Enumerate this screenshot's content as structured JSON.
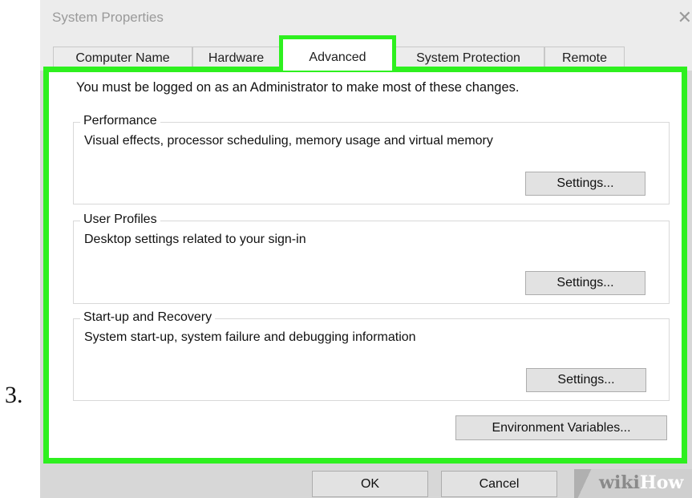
{
  "step_number": "3.",
  "window": {
    "title": "System Properties",
    "close_glyph": "✕"
  },
  "tabs": [
    {
      "label": "Computer Name",
      "active": false
    },
    {
      "label": "Hardware",
      "active": false
    },
    {
      "label": "Advanced",
      "active": true
    },
    {
      "label": "System Protection",
      "active": false
    },
    {
      "label": "Remote",
      "active": false
    }
  ],
  "admin_note": "You must be logged on as an Administrator to make most of these changes.",
  "groups": [
    {
      "title": "Performance",
      "description": "Visual effects, processor scheduling, memory usage and virtual memory",
      "button": "Settings..."
    },
    {
      "title": "User Profiles",
      "description": "Desktop settings related to your sign-in",
      "button": "Settings..."
    },
    {
      "title": "Start-up and Recovery",
      "description": "System start-up, system failure and debugging information",
      "button": "Settings..."
    }
  ],
  "env_button": "Environment Variables...",
  "footer": {
    "ok": "OK",
    "cancel": "Cancel"
  },
  "watermark": {
    "part1": "wiki",
    "part2": "How"
  },
  "colors": {
    "highlight": "#2ef01f",
    "dialog_bg": "#ececec",
    "footer_bg": "#d7d7d7"
  }
}
